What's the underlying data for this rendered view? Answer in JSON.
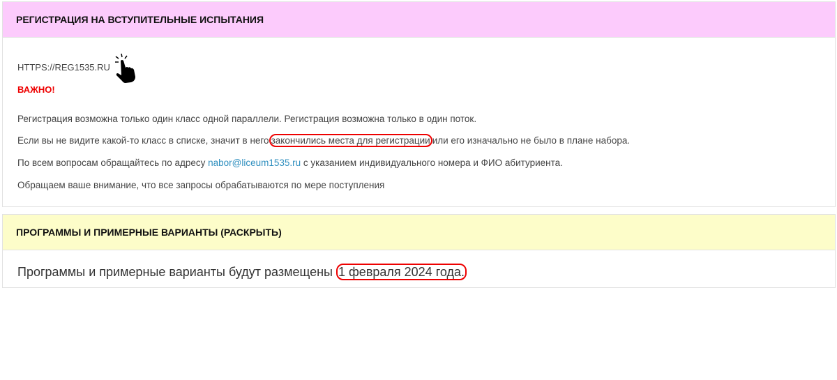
{
  "panel1": {
    "title": "РЕГИСТРАЦИЯ НА ВСТУПИТЕЛЬНЫЕ ИСПЫТАНИЯ",
    "link": "HTTPS://REG1535.RU",
    "important": "ВАЖНО!",
    "line1": "Регистрация возможна только один класс одной параллели. Регистрация возможна только в один поток.",
    "line2_a": "Если вы не видите какой-то класс в списке, значит в него",
    "line2_b": "закончились места для регистрации",
    "line2_c": "или его изначально не было в плане набора.",
    "line3_a": "По всем вопросам обращайтесь по адресу ",
    "line3_email": "nabor@liceum1535.ru",
    "line3_b": " с указанием индивидуального номера и ФИО абитуриента.",
    "line4": "Обращаем ваше внимание, что все запросы обрабатываются по мере поступления"
  },
  "panel2": {
    "title": "ПРОГРАММЫ И ПРИМЕРНЫЕ ВАРИАНТЫ (РАСКРЫТЬ)",
    "text_a": "Программы и примерные варианты будут размещены ",
    "text_b": "1 февраля 2024 года."
  },
  "colors": {
    "header1": "#fccbfc",
    "header2": "#fdfdc9",
    "link": "#2f8fbf",
    "important": "#ee0000"
  }
}
